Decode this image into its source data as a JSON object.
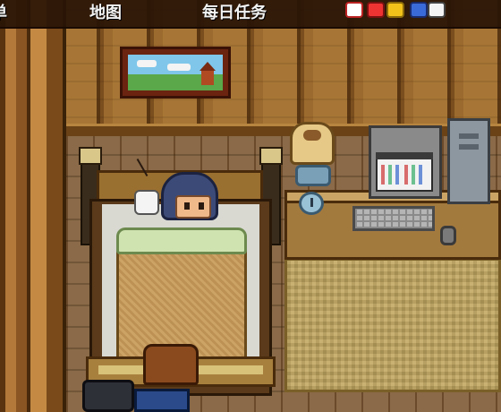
{
  "hud": {
    "menu_label": "单",
    "map_label": "地图",
    "daily_tasks_label": "每日任务"
  },
  "icons": [
    "map-icon",
    "daily-tasks-icon",
    "status-gems-icon"
  ],
  "colors": {
    "hud_background": "#281405",
    "hud_text": "#f3f3f3",
    "wall_wood": "#a77636",
    "floor_wood": "#7d5d3b"
  }
}
